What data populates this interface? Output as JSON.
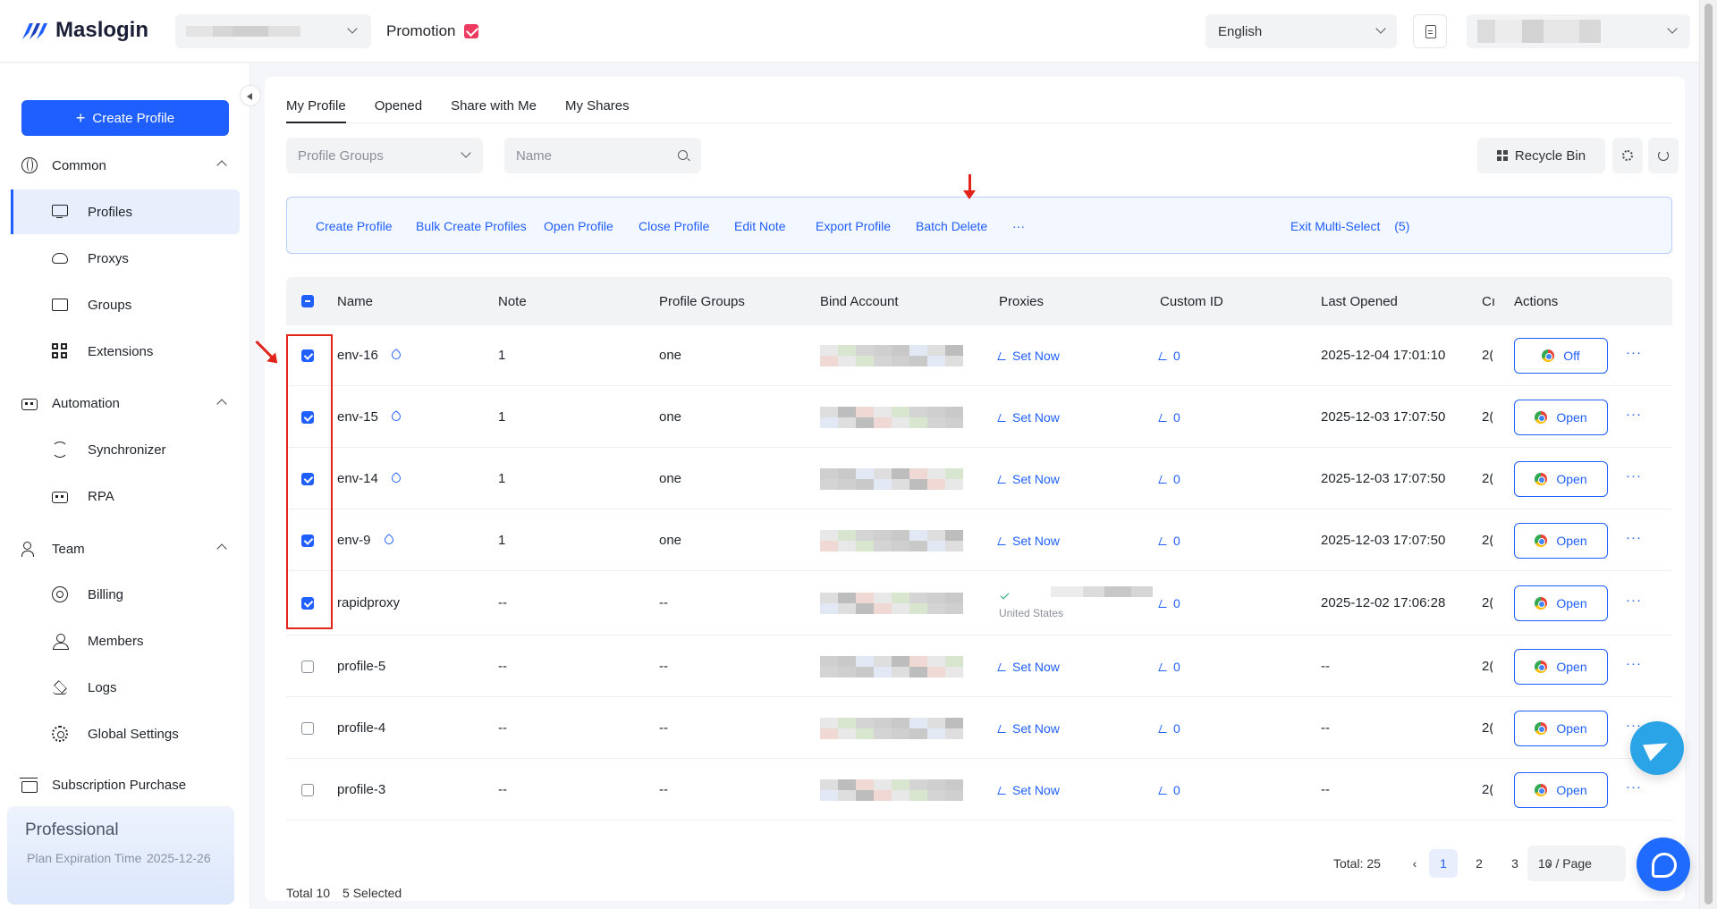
{
  "brand": {
    "name": "Maslogin",
    "accent": "#1f5eff"
  },
  "topbar": {
    "promotion_label": "Promotion",
    "language": "English"
  },
  "sidebar": {
    "create_label": "Create Profile",
    "sections": {
      "common": "Common",
      "automation": "Automation",
      "team": "Team"
    },
    "items": {
      "profiles": "Profiles",
      "proxys": "Proxys",
      "groups": "Groups",
      "extensions": "Extensions",
      "synchronizer": "Synchronizer",
      "rpa": "RPA",
      "billing": "Billing",
      "members": "Members",
      "logs": "Logs",
      "global_settings": "Global Settings"
    },
    "subscription_label": "Subscription Purchase",
    "plan": {
      "name": "Professional",
      "expiration_label": "Plan Expiration Time",
      "expiration_value": "2025-12-26"
    }
  },
  "tabs": [
    "My Profile",
    "Opened",
    "Share with Me",
    "My Shares"
  ],
  "filters": {
    "groups_placeholder": "Profile Groups",
    "name_placeholder": "Name",
    "recycle_label": "Recycle Bin"
  },
  "multi_select": {
    "actions": [
      "Create Profile",
      "Bulk Create Profiles",
      "Open Profile",
      "Close Profile",
      "Edit Note",
      "Export Profile",
      "Batch Delete",
      "···"
    ],
    "exit_label": "Exit Multi-Select",
    "count": "(5)"
  },
  "table": {
    "headers": [
      "Name",
      "Note",
      "Profile Groups",
      "Bind Account",
      "Proxies",
      "Custom ID",
      "Last Opened",
      "Cı",
      "Actions"
    ],
    "set_now": "Set Now",
    "rows": [
      {
        "name": "env-16",
        "note": "1",
        "group": "one",
        "pinned": true,
        "checked": true,
        "proxy": "Set Now",
        "custom_id": "0",
        "last_opened": "2025-12-04 17:01:10",
        "created": "2(",
        "action": "Off"
      },
      {
        "name": "env-15",
        "note": "1",
        "group": "one",
        "pinned": true,
        "checked": true,
        "proxy": "Set Now",
        "custom_id": "0",
        "last_opened": "2025-12-03 17:07:50",
        "created": "2(",
        "action": "Open"
      },
      {
        "name": "env-14",
        "note": "1",
        "group": "one",
        "pinned": true,
        "checked": true,
        "proxy": "Set Now",
        "custom_id": "0",
        "last_opened": "2025-12-03 17:07:50",
        "created": "2(",
        "action": "Open"
      },
      {
        "name": "env-9",
        "note": "1",
        "group": "one",
        "pinned": true,
        "checked": true,
        "proxy": "Set Now",
        "custom_id": "0",
        "last_opened": "2025-12-03 17:07:50",
        "created": "2(",
        "action": "Open"
      },
      {
        "name": "rapidproxy",
        "note": "--",
        "group": "--",
        "pinned": false,
        "checked": true,
        "proxy": "United States",
        "custom_id": "0",
        "last_opened": "2025-12-02 17:06:28",
        "created": "2(",
        "action": "Open"
      },
      {
        "name": "profile-5",
        "note": "--",
        "group": "--",
        "pinned": false,
        "checked": false,
        "proxy": "Set Now",
        "custom_id": "0",
        "last_opened": "--",
        "created": "2(",
        "action": "Open"
      },
      {
        "name": "profile-4",
        "note": "--",
        "group": "--",
        "pinned": false,
        "checked": false,
        "proxy": "Set Now",
        "custom_id": "0",
        "last_opened": "--",
        "created": "2(",
        "action": "Open"
      },
      {
        "name": "profile-3",
        "note": "--",
        "group": "--",
        "pinned": false,
        "checked": false,
        "proxy": "Set Now",
        "custom_id": "0",
        "last_opened": "--",
        "created": "2(",
        "action": "Open"
      }
    ]
  },
  "footer": {
    "total": "Total 10",
    "selected": "5 Selected"
  },
  "pagination": {
    "total": "Total: 25",
    "pages": [
      "1",
      "2",
      "3"
    ],
    "page_size": "10 / Page",
    "prev": "‹",
    "next": "›"
  }
}
